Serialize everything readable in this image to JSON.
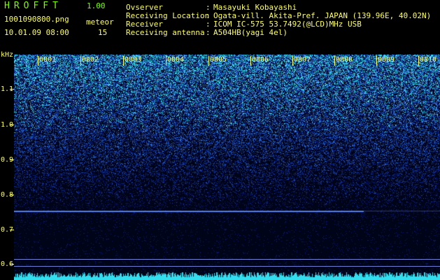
{
  "app": {
    "title": "HROFFT",
    "version": "1.00"
  },
  "capture": {
    "file": "1001090800.png",
    "timestamp": "10.01.09 08:00",
    "meteor_label": "meteor",
    "meteor_count": "15"
  },
  "meta": [
    {
      "key": "Ovserver",
      "value": "Masayuki Kobayashi"
    },
    {
      "key": "Receiving Location",
      "value": "Ogata-vill. Akita-Pref. JAPAN (139.96E, 40.02N)"
    },
    {
      "key": "Receiver",
      "value": "ICOM IC-575 53.7492(@LCD)MHz USB"
    },
    {
      "key": "Receiving antenna",
      "value": "A504HB(yagi 4el)"
    }
  ],
  "y_axis": {
    "unit": "kHz",
    "ticks": [
      "1.1",
      "1.0",
      "0.9",
      "0.8",
      "0.7",
      "0.6"
    ]
  },
  "x_axis": {
    "ticks": [
      "0801",
      "0802",
      "0803",
      "0804",
      "0805",
      "0806",
      "0807",
      "0808",
      "0809",
      "0810"
    ]
  },
  "colors": {
    "label": "#ffff66",
    "title": "#7cfc00",
    "noise_low": "#000a30",
    "noise_high": "#33ddee"
  }
}
